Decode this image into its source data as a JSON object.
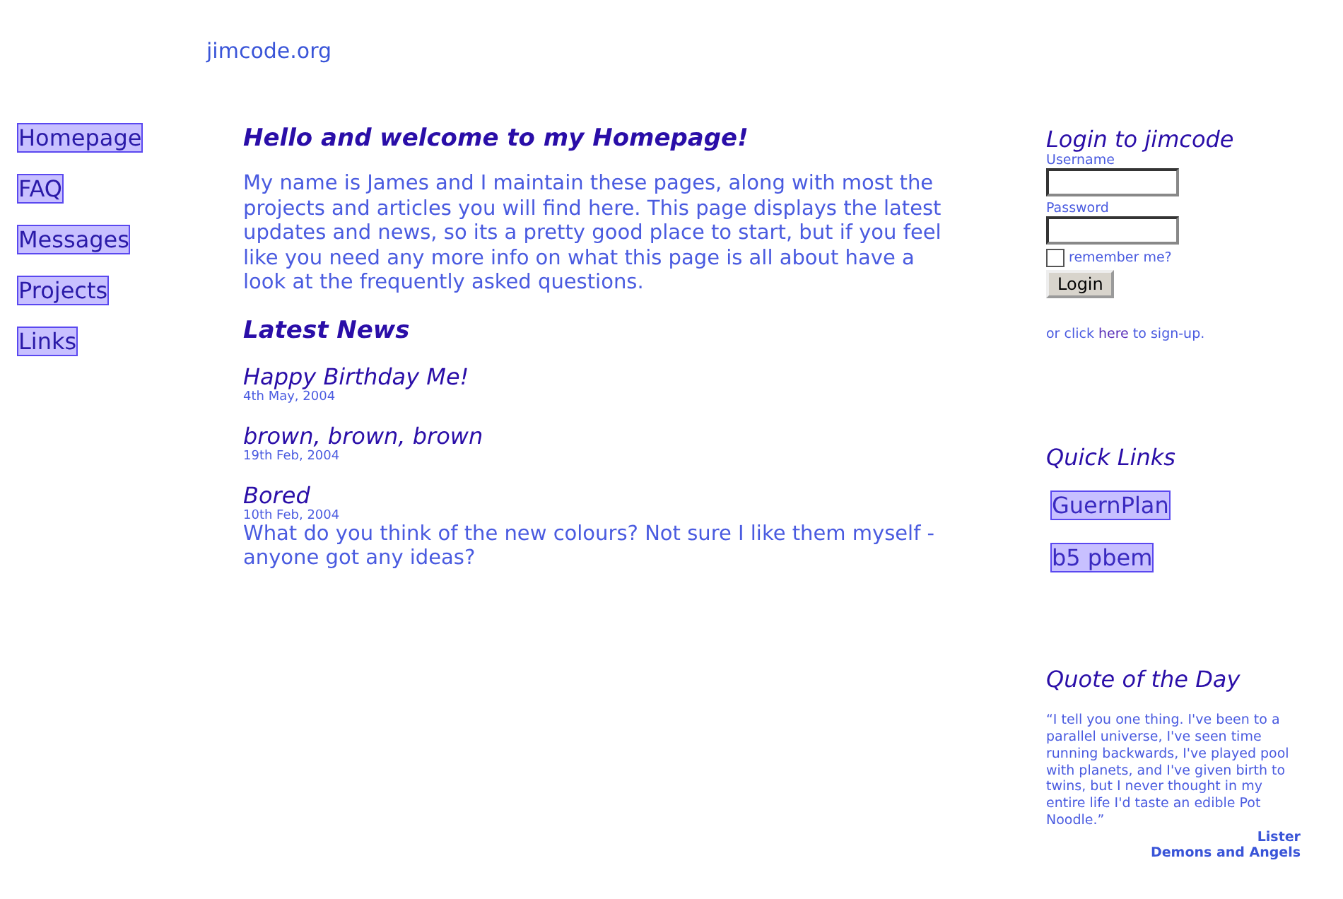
{
  "site_title": "jimcode.org",
  "nav": [
    {
      "label": "Homepage"
    },
    {
      "label": "FAQ"
    },
    {
      "label": "Messages"
    },
    {
      "label": "Projects"
    },
    {
      "label": "Links"
    }
  ],
  "main": {
    "heading": "Hello and welcome to my Homepage!",
    "intro": "My name is James and I maintain these pages, along with most the projects and articles you will find here. This page displays the latest updates and news, so its a pretty good place to start, but if you feel like you need any more info on what this page is all about have a look at the frequently asked questions.",
    "news_heading": "Latest News",
    "news": [
      {
        "title": "Happy Birthday Me!",
        "date": "4th May, 2004"
      },
      {
        "title": "brown, brown, brown",
        "date": "19th Feb, 2004"
      },
      {
        "title": "Bored",
        "date": "10th Feb, 2004",
        "body": "What do you think of the new colours? Not sure I like them myself - anyone got any ideas?"
      }
    ]
  },
  "login": {
    "heading": "Login to jimcode",
    "username_label": "Username",
    "password_label": "Password",
    "remember": {
      "label": "remember me?",
      "checked": false
    },
    "button": "Login",
    "signup": {
      "before": "or click ",
      "link": "here",
      "after": " to sign-up."
    }
  },
  "quick_links": {
    "heading": "Quick Links",
    "items": [
      {
        "label": "GuernPlan"
      },
      {
        "label": "b5 pbem"
      }
    ]
  },
  "quote": {
    "heading": "Quote of the Day",
    "text": "“I tell you one thing. I've been to a parallel universe, I've seen time running backwards, I've played pool with planets, and I've given birth to twins, but I never thought in my entire life I'd taste an edible Pot Noodle.”",
    "author": "Lister",
    "source": "Demons and Angels"
  }
}
